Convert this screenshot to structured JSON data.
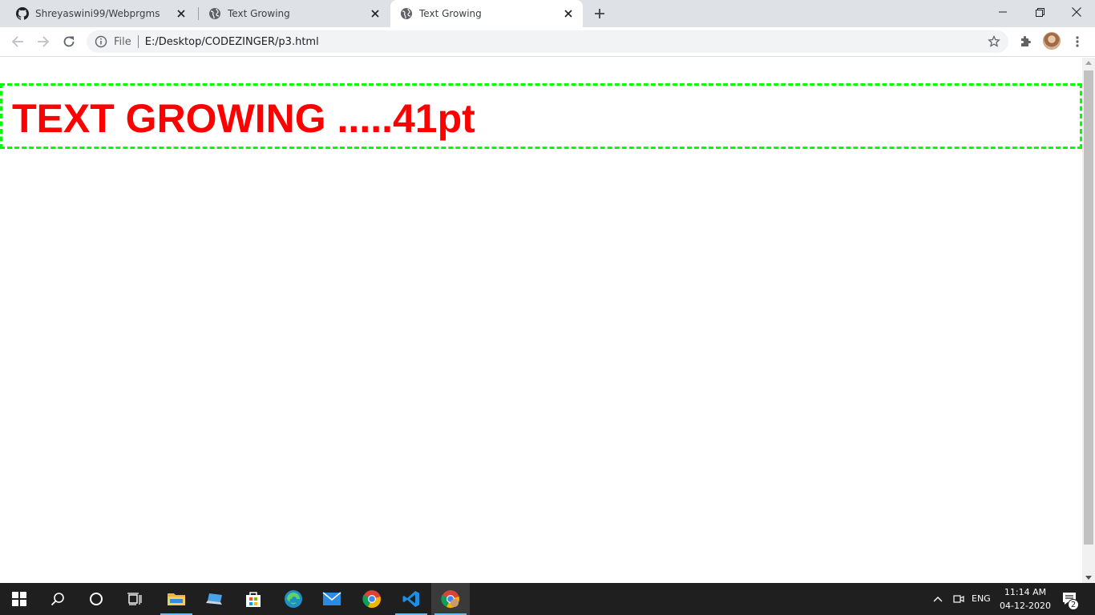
{
  "browser": {
    "tabs": [
      {
        "title": "Shreyaswini99/Webprgms",
        "favicon": "github-icon",
        "active": false
      },
      {
        "title": "Text Growing",
        "favicon": "globe-icon",
        "active": false
      },
      {
        "title": "Text Growing",
        "favicon": "globe-icon",
        "active": true
      }
    ],
    "address": {
      "scheme_label": "File",
      "url": "E:/Desktop/CODEZINGER/p3.html"
    }
  },
  "page": {
    "growing_text": "TEXT GROWING .....41pt",
    "text_color": "#ff0000",
    "border_color": "#00ff00"
  },
  "taskbar": {
    "language": "ENG",
    "time": "11:14 AM",
    "date": "04-12-2020",
    "notification_count": "2",
    "pinned": [
      "start-icon",
      "search-icon",
      "cortana-icon",
      "task-view-icon",
      "file-explorer-icon",
      "laptop-icon",
      "store-icon",
      "edge-icon",
      "mail-icon",
      "chrome-icon",
      "vscode-icon",
      "chrome-profile-icon"
    ]
  }
}
